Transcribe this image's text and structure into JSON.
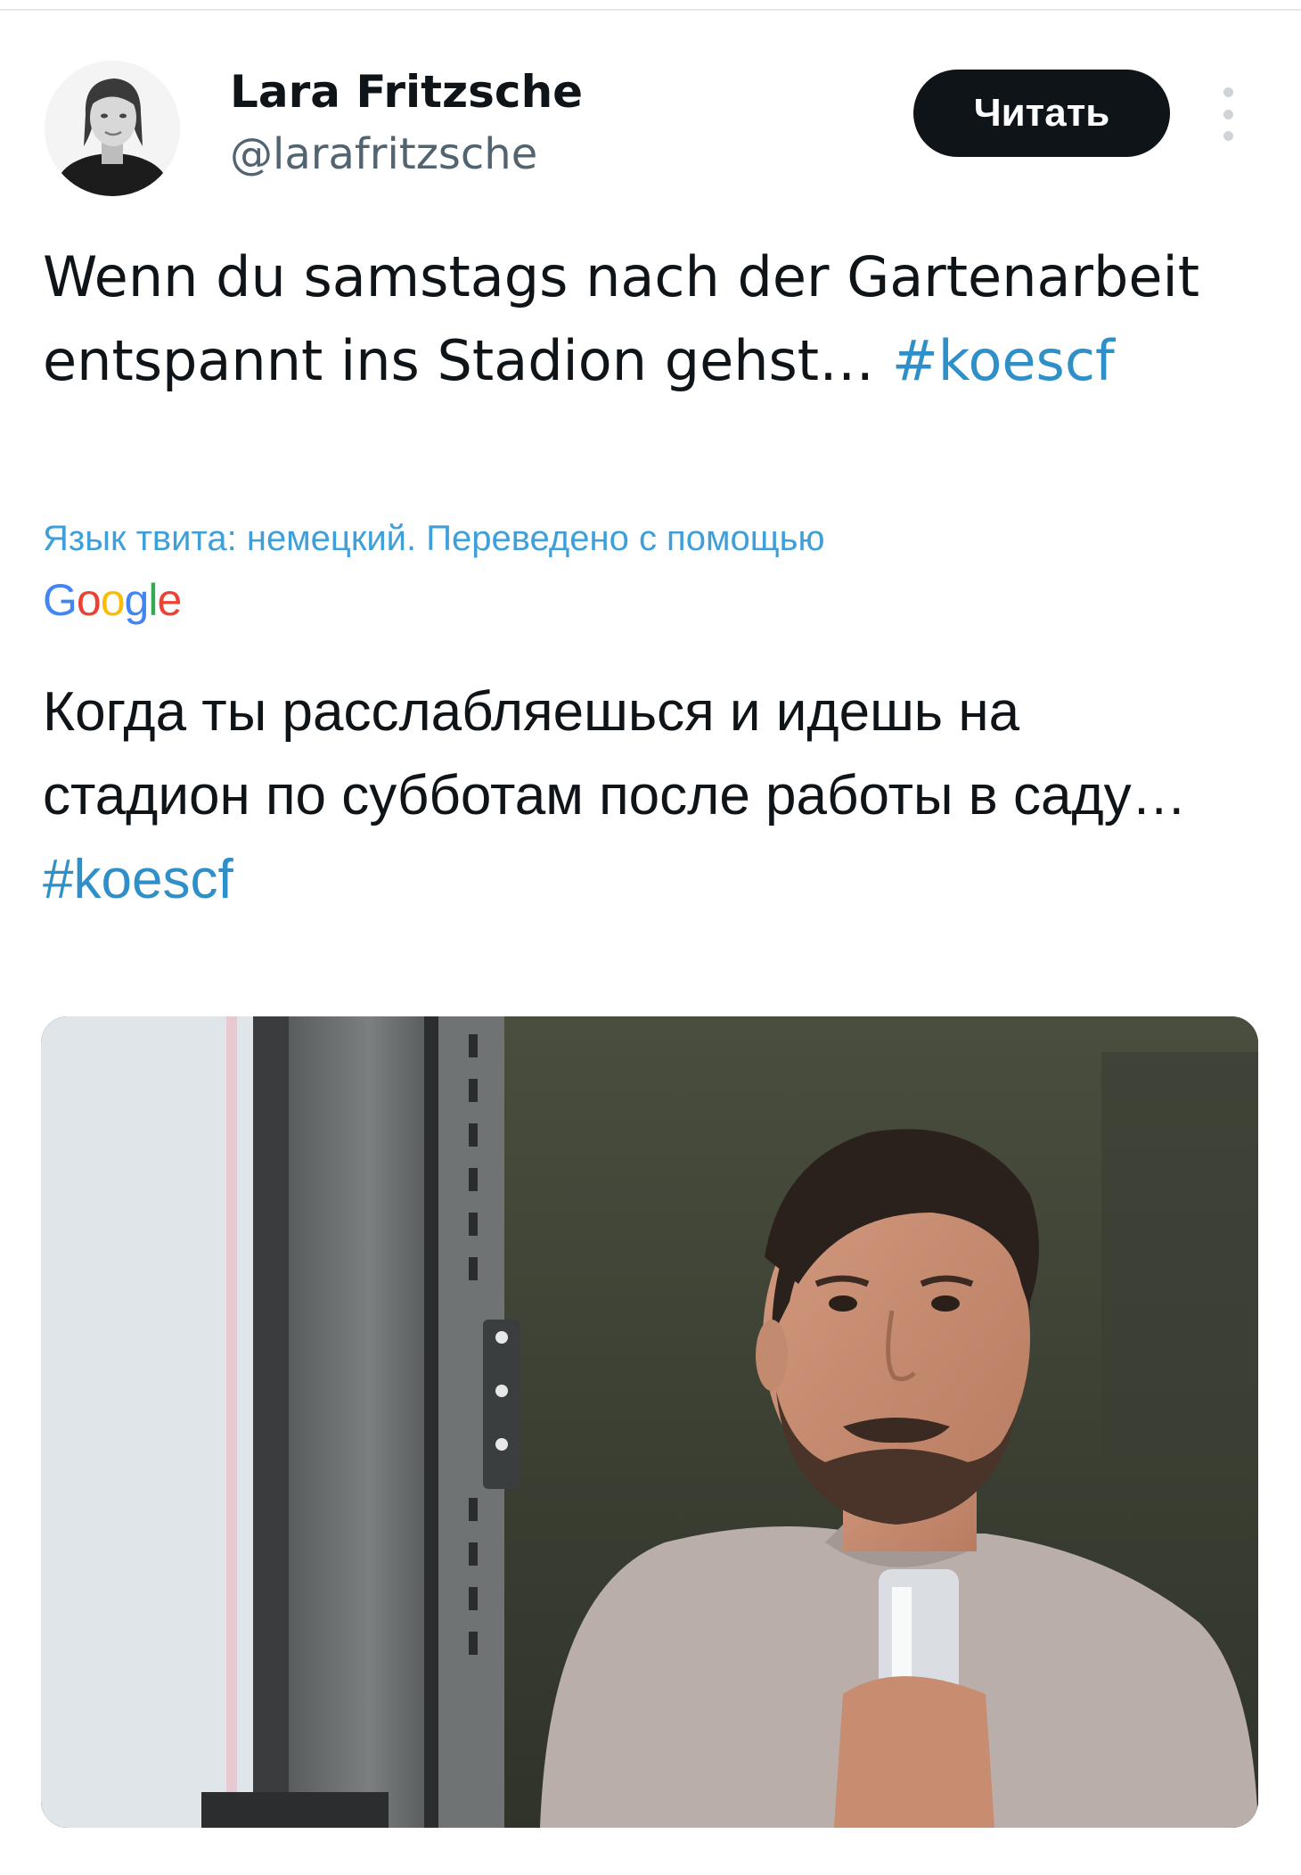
{
  "tweet": {
    "author": {
      "name": "Lara Fritzsche",
      "handle": "@larafritzsche"
    },
    "follow_label": "Читать",
    "original_text": "Wenn du samstags nach der Gartenarbeit entspannt ins Stadion gehst… ",
    "hashtag": "#koescf",
    "translation_note": "Язык твита: немецкий. Переведено с помощью",
    "translation_provider": "Google",
    "translated_text": "Когда ты расслабляешься и идешь на стадион по субботам после работы в саду… "
  },
  "colors": {
    "link": "#1d9bf0",
    "button_bg": "#0f1419",
    "text": "#0f1419",
    "secondary_text": "#536471"
  },
  "icons": {
    "more": "more-vertical-icon"
  }
}
